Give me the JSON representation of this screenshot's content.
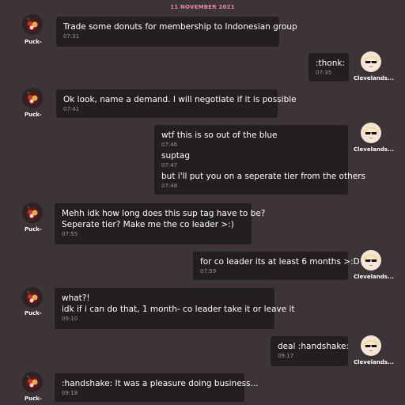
{
  "date_header": "11 NOVEMBER 2021",
  "users": {
    "puck": "Puck-",
    "cleveland": "Clevelands..."
  },
  "messages": [
    {
      "sender": "puck",
      "lines": [
        {
          "text": "Trade some donuts for membership to Indonesian group",
          "time": "07:31"
        }
      ]
    },
    {
      "sender": "cleveland",
      "lines": [
        {
          "text": ":thonk:",
          "time": "07:35"
        }
      ]
    },
    {
      "sender": "puck",
      "lines": [
        {
          "text": "Ok look, name a demand. I will negotiate if it is possible",
          "time": "07:41"
        }
      ]
    },
    {
      "sender": "cleveland",
      "lines": [
        {
          "text": "wtf this is so out of the blue",
          "time": "07:46"
        },
        {
          "text": "suptag",
          "time": "07:47"
        },
        {
          "text": "but i'll put you on a seperate tier from the others",
          "time": "07:48"
        }
      ]
    },
    {
      "sender": "puck",
      "lines": [
        {
          "text": "Mehh idk how long does this sup tag have to be?",
          "time": ""
        },
        {
          "text": "Seperate tier? Make me the co leader >:)",
          "time": "07:55"
        }
      ]
    },
    {
      "sender": "cleveland",
      "lines": [
        {
          "text": "for co leader its at least 6 months >:D",
          "time": "07:59"
        }
      ]
    },
    {
      "sender": "puck",
      "lines": [
        {
          "text": "what?!",
          "time": ""
        },
        {
          "text": "idk if i can do that, 1 month- co leader take it or leave it",
          "time": "09:10"
        }
      ]
    },
    {
      "sender": "cleveland",
      "lines": [
        {
          "text": "deal :handshake:",
          "time": "09:17"
        }
      ]
    },
    {
      "sender": "puck",
      "lines": [
        {
          "text": ":handshake: It was a pleasure doing business...",
          "time": "09:18"
        }
      ]
    }
  ]
}
